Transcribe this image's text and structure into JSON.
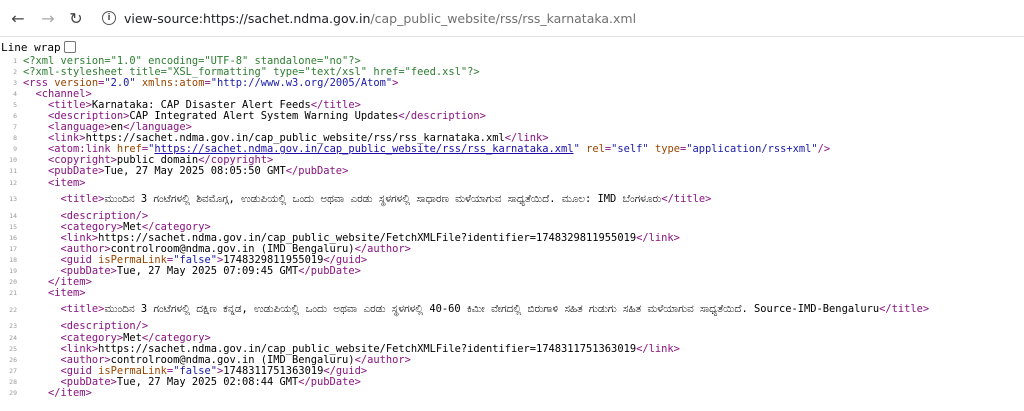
{
  "browser": {
    "url_host": "view-source:https://sachet.ndma.gov.in",
    "url_path": "/cap_public_website/rss/rss_karnataka.xml",
    "back_icon": "arrow-left",
    "forward_icon": "arrow-right",
    "reload_icon": "reload",
    "info_icon": "info"
  },
  "linewrap": {
    "label": "Line wrap",
    "checked": false
  },
  "lines": [
    {
      "n": "1",
      "parts": [
        [
          "pi",
          "<?xml version=\"1.0\" encoding=\"UTF-8\" standalone=\"no\"?>"
        ]
      ]
    },
    {
      "n": "2",
      "parts": [
        [
          "pi",
          "<?xml-stylesheet title=\"XSL_formatting\" type=\"text/xsl\" href=\"feed.xsl\"?>"
        ]
      ]
    },
    {
      "n": "3",
      "parts": [
        [
          "tag",
          "<rss "
        ],
        [
          "attr",
          "version"
        ],
        [
          "tag",
          "="
        ],
        [
          "val",
          "\"2.0\""
        ],
        [
          "tag",
          " "
        ],
        [
          "attr",
          "xmlns:atom"
        ],
        [
          "tag",
          "="
        ],
        [
          "val",
          "\"http://www.w3.org/2005/Atom\""
        ],
        [
          "tag",
          ">"
        ]
      ]
    },
    {
      "n": "4",
      "parts": [
        [
          "txt",
          "  "
        ],
        [
          "tag",
          "<channel>"
        ]
      ]
    },
    {
      "n": "5",
      "parts": [
        [
          "txt",
          "    "
        ],
        [
          "tag",
          "<title>"
        ],
        [
          "txt",
          "Karnataka: CAP Disaster Alert Feeds"
        ],
        [
          "tag",
          "</title>"
        ]
      ]
    },
    {
      "n": "6",
      "parts": [
        [
          "txt",
          "    "
        ],
        [
          "tag",
          "<description>"
        ],
        [
          "txt",
          "CAP Integrated Alert System Warning Updates"
        ],
        [
          "tag",
          "</description>"
        ]
      ]
    },
    {
      "n": "7",
      "parts": [
        [
          "txt",
          "    "
        ],
        [
          "tag",
          "<language>"
        ],
        [
          "txt",
          "en"
        ],
        [
          "tag",
          "</language>"
        ]
      ]
    },
    {
      "n": "8",
      "parts": [
        [
          "txt",
          "    "
        ],
        [
          "tag",
          "<link>"
        ],
        [
          "txt",
          "https://sachet.ndma.gov.in/cap_public_website/rss/rss_karnataka.xml"
        ],
        [
          "tag",
          "</link>"
        ]
      ]
    },
    {
      "n": "9",
      "parts": [
        [
          "txt",
          "    "
        ],
        [
          "tag",
          "<atom:link "
        ],
        [
          "attr",
          "href"
        ],
        [
          "tag",
          "="
        ],
        [
          "val",
          "\""
        ],
        [
          "link",
          "https://sachet.ndma.gov.in/cap_public_website/rss/rss_karnataka.xml"
        ],
        [
          "val",
          "\""
        ],
        [
          "tag",
          " "
        ],
        [
          "attr",
          "rel"
        ],
        [
          "tag",
          "="
        ],
        [
          "val",
          "\"self\""
        ],
        [
          "tag",
          " "
        ],
        [
          "attr",
          "type"
        ],
        [
          "tag",
          "="
        ],
        [
          "val",
          "\"application/rss+xml\""
        ],
        [
          "tag",
          "/>"
        ]
      ]
    },
    {
      "n": "10",
      "parts": [
        [
          "txt",
          "    "
        ],
        [
          "tag",
          "<copyright>"
        ],
        [
          "txt",
          "public domain"
        ],
        [
          "tag",
          "</copyright>"
        ]
      ]
    },
    {
      "n": "11",
      "parts": [
        [
          "txt",
          "    "
        ],
        [
          "tag",
          "<pubDate>"
        ],
        [
          "txt",
          "Tue, 27 May 2025 08:05:50 GMT"
        ],
        [
          "tag",
          "</pubDate>"
        ]
      ]
    },
    {
      "n": "12",
      "parts": [
        [
          "txt",
          "    "
        ],
        [
          "tag",
          "<item>"
        ]
      ]
    },
    {
      "n": "13",
      "tall": true,
      "parts": [
        [
          "txt",
          "      "
        ],
        [
          "tag",
          "<title>"
        ],
        [
          "txt",
          "ಮುಂದಿನ 3 ಗಂಟೆಗಳಲ್ಲಿ ಶಿವಮೊಗ್ಗ, ಉಡುಪಿಯಲ್ಲಿ ಒಂದು ಅಥವಾ ಎರಡು ಸ್ಥಳಗಳಲ್ಲಿ ಸಾಧಾರಣ ಮಳೆಯಾಗುವ ಸಾಧ್ಯತೆಯಿದೆ. ಮೂಲ: IMD ಬೆಂಗಳೂರು"
        ],
        [
          "tag",
          "</title>"
        ]
      ]
    },
    {
      "n": "14",
      "parts": [
        [
          "txt",
          "      "
        ],
        [
          "tag",
          "<description/>"
        ]
      ]
    },
    {
      "n": "15",
      "parts": [
        [
          "txt",
          "      "
        ],
        [
          "tag",
          "<category>"
        ],
        [
          "txt",
          "Met"
        ],
        [
          "tag",
          "</category>"
        ]
      ]
    },
    {
      "n": "16",
      "parts": [
        [
          "txt",
          "      "
        ],
        [
          "tag",
          "<link>"
        ],
        [
          "txt",
          "https://sachet.ndma.gov.in/cap_public_website/FetchXMLFile?identifier=1748329811955019"
        ],
        [
          "tag",
          "</link>"
        ]
      ]
    },
    {
      "n": "17",
      "parts": [
        [
          "txt",
          "      "
        ],
        [
          "tag",
          "<author>"
        ],
        [
          "txt",
          "controlroom@ndma.gov.in (IMD Bengaluru)"
        ],
        [
          "tag",
          "</author>"
        ]
      ]
    },
    {
      "n": "18",
      "parts": [
        [
          "txt",
          "      "
        ],
        [
          "tag",
          "<guid "
        ],
        [
          "attr",
          "isPermaLink"
        ],
        [
          "tag",
          "="
        ],
        [
          "val",
          "\"false\""
        ],
        [
          "tag",
          ">"
        ],
        [
          "txt",
          "1748329811955019"
        ],
        [
          "tag",
          "</guid>"
        ]
      ]
    },
    {
      "n": "19",
      "parts": [
        [
          "txt",
          "      "
        ],
        [
          "tag",
          "<pubDate>"
        ],
        [
          "txt",
          "Tue, 27 May 2025 07:09:45 GMT"
        ],
        [
          "tag",
          "</pubDate>"
        ]
      ]
    },
    {
      "n": "20",
      "parts": [
        [
          "txt",
          "    "
        ],
        [
          "tag",
          "</item>"
        ]
      ]
    },
    {
      "n": "21",
      "parts": [
        [
          "txt",
          "    "
        ],
        [
          "tag",
          "<item>"
        ]
      ]
    },
    {
      "n": "22",
      "tall": true,
      "parts": [
        [
          "txt",
          "      "
        ],
        [
          "tag",
          "<title>"
        ],
        [
          "txt",
          "ಮುಂದಿನ 3 ಗಂಟೆಗಳಲ್ಲಿ ದಕ್ಷಿಣ ಕನ್ನಡ, ಉಡುಪಿಯಲ್ಲಿ ಒಂದು ಅಥವಾ ಎರಡು ಸ್ಥಳಗಳಲ್ಲಿ 40-60 ಕಿಮೀ ವೇಗದಲ್ಲಿ ಬಿರುಗಾಳಿ ಸಹಿತ ಗುಡುಗು ಸಹಿತ ಮಳೆಯಾಗುವ ಸಾಧ್ಯತೆಯಿದೆ. Source-IMD-Bengaluru"
        ],
        [
          "tag",
          "</title>"
        ]
      ]
    },
    {
      "n": "23",
      "parts": [
        [
          "txt",
          "      "
        ],
        [
          "tag",
          "<description/>"
        ]
      ]
    },
    {
      "n": "24",
      "parts": [
        [
          "txt",
          "      "
        ],
        [
          "tag",
          "<category>"
        ],
        [
          "txt",
          "Met"
        ],
        [
          "tag",
          "</category>"
        ]
      ]
    },
    {
      "n": "25",
      "parts": [
        [
          "txt",
          "      "
        ],
        [
          "tag",
          "<link>"
        ],
        [
          "txt",
          "https://sachet.ndma.gov.in/cap_public_website/FetchXMLFile?identifier=1748311751363019"
        ],
        [
          "tag",
          "</link>"
        ]
      ]
    },
    {
      "n": "26",
      "parts": [
        [
          "txt",
          "      "
        ],
        [
          "tag",
          "<author>"
        ],
        [
          "txt",
          "controlroom@ndma.gov.in (IMD Bengaluru)"
        ],
        [
          "tag",
          "</author>"
        ]
      ]
    },
    {
      "n": "27",
      "parts": [
        [
          "txt",
          "      "
        ],
        [
          "tag",
          "<guid "
        ],
        [
          "attr",
          "isPermaLink"
        ],
        [
          "tag",
          "="
        ],
        [
          "val",
          "\"false\""
        ],
        [
          "tag",
          ">"
        ],
        [
          "txt",
          "1748311751363019"
        ],
        [
          "tag",
          "</guid>"
        ]
      ]
    },
    {
      "n": "28",
      "parts": [
        [
          "txt",
          "      "
        ],
        [
          "tag",
          "<pubDate>"
        ],
        [
          "txt",
          "Tue, 27 May 2025 02:08:44 GMT"
        ],
        [
          "tag",
          "</pubDate>"
        ]
      ]
    },
    {
      "n": "29",
      "parts": [
        [
          "txt",
          "    "
        ],
        [
          "tag",
          "</item>"
        ]
      ]
    }
  ]
}
